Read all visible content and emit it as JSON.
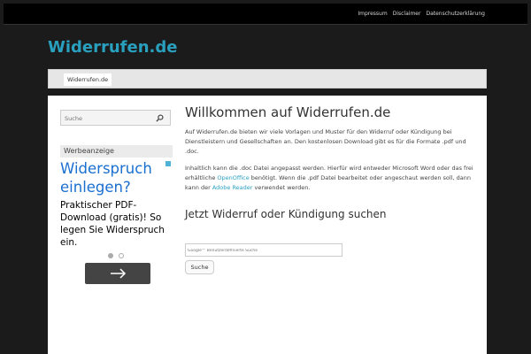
{
  "top_links": [
    "Impressum",
    "Disclaimer",
    "Datenschutzerklärung"
  ],
  "site_title": "Widerrufen.de",
  "nav": {
    "tab": "Widerrufen.de"
  },
  "sidebar": {
    "search_placeholder": "Suche",
    "ad_label": "Werbeanzeige",
    "ad": {
      "headline": "Widerspruch einlegen?",
      "text": "Praktischer PDF-Download (gratis)! So legen Sie Widerspruch ein.",
      "button_icon": "arrow-right-icon"
    }
  },
  "main": {
    "title": "Willkommen auf Widerrufen.de",
    "p1": "Auf Widerrufen.de bieten wir viele Vorlagen und Muster für den Widerruf oder Kündigung bei Dienstleistern und Gesellschaften an. Den kostenlosen Download gibt es für die Formate .pdf und .doc.",
    "p2_a": "Inhaltlich kann die .doc Datei angepasst werden. Hierfür wird entweder Microsoft Word oder das frei erhältliche ",
    "p2_link1": "OpenOffice",
    "p2_b": " benötigt. Wenn die .pdf Datei bearbeitet oder angeschaut werden soll, dann kann der ",
    "p2_link2": "Adobe Reader",
    "p2_c": " verwendet werden.",
    "subtitle": "Jetzt Widerruf oder Kündigung suchen",
    "search_placeholder": "Google™ Benutzerdefinierte Suche",
    "search_button": "Suche"
  },
  "colors": {
    "accent": "#2aa0bf",
    "background": "#1b1b1b",
    "ad_blue": "#1a6fd0"
  }
}
